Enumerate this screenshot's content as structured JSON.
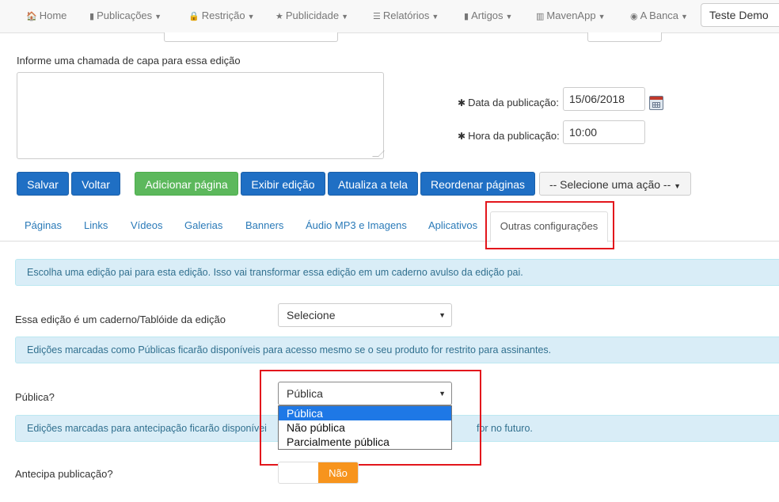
{
  "navbar": {
    "items": [
      {
        "label": "Home",
        "icon": "home-icon",
        "glyph": "🏠"
      },
      {
        "label": "Publicações",
        "icon": "file-icon",
        "glyph": "▮"
      },
      {
        "label": "Restrição",
        "icon": "lock-icon",
        "glyph": "🔒"
      },
      {
        "label": "Publicidade",
        "icon": "star-icon",
        "glyph": "★"
      },
      {
        "label": "Relatórios",
        "icon": "list-icon",
        "glyph": "☰"
      },
      {
        "label": "Artigos",
        "icon": "book-icon",
        "glyph": "▮"
      },
      {
        "label": "MavenApp",
        "icon": "barcode-icon",
        "glyph": "▥"
      },
      {
        "label": "A Banca",
        "icon": "globe-icon",
        "glyph": "◉"
      }
    ],
    "user": "Teste Demo"
  },
  "form": {
    "cover_call_label": "Informe uma chamada de capa para essa edição",
    "cover_call_value": "",
    "date_label": "Data da publicação:",
    "date_value": "15/06/2018",
    "time_label": "Hora da publicação:",
    "time_value": "10:00",
    "required_mark": "✱"
  },
  "buttons": {
    "save": "Salvar",
    "back": "Voltar",
    "add_page": "Adicionar página",
    "show_edition": "Exibir edição",
    "refresh": "Atualiza a tela",
    "reorder": "Reordenar páginas",
    "select_action": "-- Selecione uma ação --"
  },
  "tabs": [
    "Páginas",
    "Links",
    "Vídeos",
    "Galerias",
    "Banners",
    "Áudio MP3 e Imagens",
    "Aplicativos",
    "Outras configurações"
  ],
  "settings": {
    "alert_parent": "Escolha uma edição pai para esta edição. Isso vai transformar essa edição em um caderno avulso da edição pai.",
    "parent_label": "Essa edição é um caderno/Tablóide da edição",
    "parent_value": "Selecione",
    "alert_public": "Edições marcadas como Públicas ficarão disponíveis para acesso mesmo se o seu produto for restrito para assinantes.",
    "public_label": "Pública?",
    "public_value": "Pública",
    "public_options": [
      "Pública",
      "Não pública",
      "Parcialmente pública"
    ],
    "alert_anticipation_left": "Edições marcadas para antecipação ficarão disponívei",
    "alert_anticipation_right": "for no futuro.",
    "anticipate_label": "Antecipa publicação?",
    "anticipate_value": "Não"
  },
  "colors": {
    "primary": "#1f6fc4",
    "success": "#5cb85c",
    "alert_bg": "#d9edf7",
    "highlight": "#e3161c",
    "toggle_off": "#f7941d"
  }
}
